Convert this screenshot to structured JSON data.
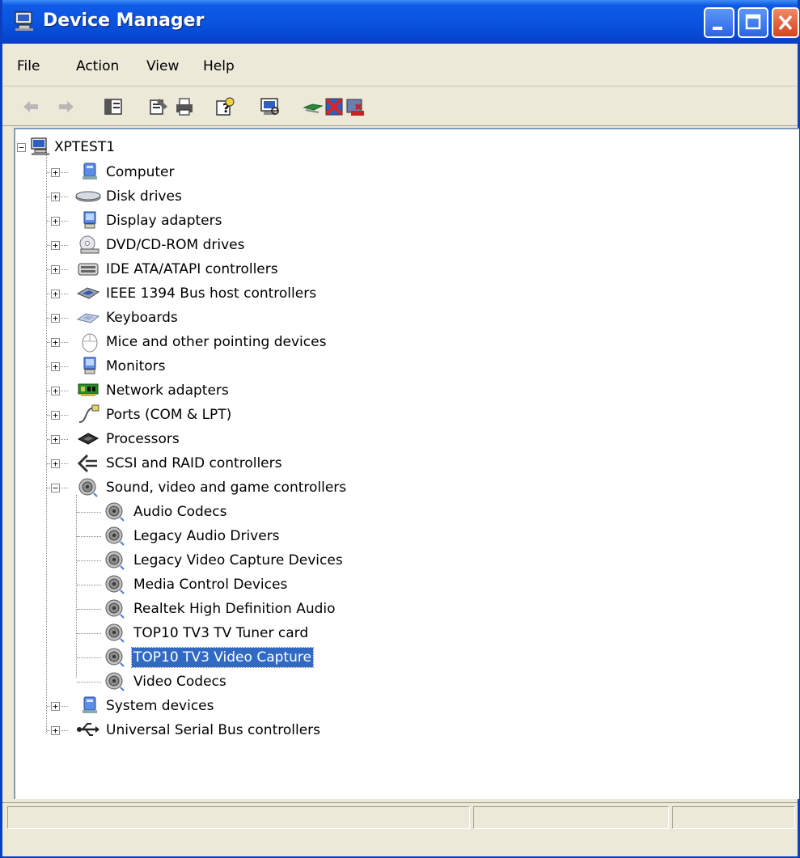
{
  "window": {
    "title": "Device Manager"
  },
  "menu": {
    "file": "File",
    "action": "Action",
    "view": "View",
    "help": "Help"
  },
  "tree": {
    "root": "XPTEST1",
    "categories": [
      "Computer",
      "Disk drives",
      "Display adapters",
      "DVD/CD-ROM drives",
      "IDE ATA/ATAPI controllers",
      "IEEE 1394 Bus host controllers",
      "Keyboards",
      "Mice and other pointing devices",
      "Monitors",
      "Network adapters",
      "Ports (COM & LPT)",
      "Processors",
      "SCSI and RAID controllers",
      "Sound, video and game controllers",
      "System devices",
      "Universal Serial Bus controllers"
    ],
    "sound_children": [
      "Audio Codecs",
      "Legacy Audio Drivers",
      "Legacy Video Capture Devices",
      "Media Control Devices",
      "Realtek High Definition Audio",
      "TOP10 TV3 TV Tuner card",
      "TOP10 TV3 Video Capture",
      "Video Codecs"
    ],
    "selected": "TOP10 TV3 Video Capture"
  },
  "colors": {
    "titlebar": "#0a55e0",
    "selection": "#316ac5",
    "chrome": "#ece9d8"
  }
}
